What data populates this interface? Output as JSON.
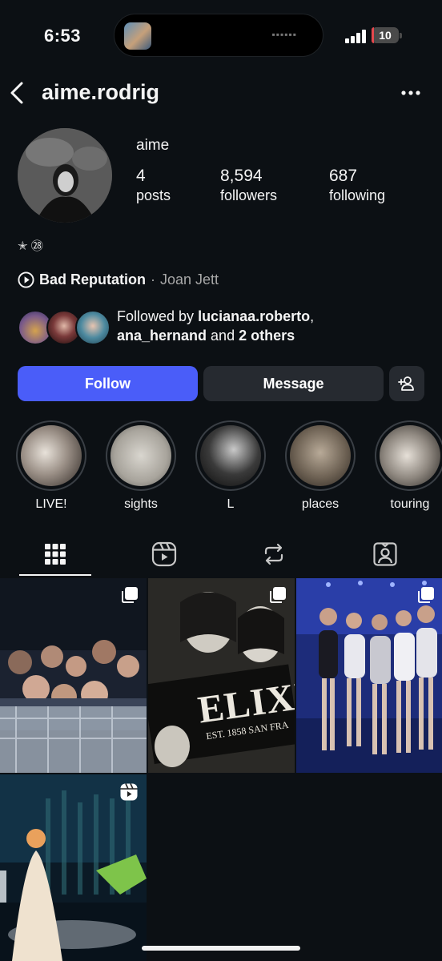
{
  "status_bar": {
    "time": "6:53",
    "battery": "10",
    "battery_level": 0.1,
    "battery_color": "#e5484d"
  },
  "header": {
    "username": "aime.rodrig",
    "back_icon": "chevron-left-icon",
    "more_icon": "more-horizontal-icon"
  },
  "profile": {
    "display_name": "aime",
    "stats": [
      {
        "value": "4",
        "label": "posts"
      },
      {
        "value": "8,594",
        "label": "followers"
      },
      {
        "value": "687",
        "label": "following"
      }
    ],
    "bio": "✭ ㉘",
    "music": {
      "song": "Bad Reputation",
      "separator": "·",
      "artist": "Joan Jett"
    },
    "followed_by": {
      "prefix": "Followed by ",
      "first": "lucianaa.roberto",
      "comma": ",",
      "second": "ana_hernand",
      "and": " and ",
      "others": "2 others"
    }
  },
  "actions": {
    "follow": "Follow",
    "message": "Message",
    "add_user_icon": "add-user-icon",
    "follow_color": "#4a5df9"
  },
  "highlights": [
    {
      "label": "LIVE!"
    },
    {
      "label": "sights"
    },
    {
      "label": "L"
    },
    {
      "label": "places"
    },
    {
      "label": "touring"
    }
  ],
  "tabs": [
    {
      "icon": "grid-icon",
      "active": true
    },
    {
      "icon": "reels-icon",
      "active": false
    },
    {
      "icon": "reposts-icon",
      "active": false
    },
    {
      "icon": "tagged-icon",
      "active": false
    }
  ],
  "posts": [
    {
      "type": "carousel",
      "icon": "carousel-icon"
    },
    {
      "type": "carousel",
      "icon": "carousel-icon",
      "caption_text": "ELIXI",
      "caption_sub": "EST. 1858 SAN FRA"
    },
    {
      "type": "carousel",
      "icon": "carousel-icon"
    },
    {
      "type": "reel",
      "icon": "reel-icon"
    }
  ]
}
